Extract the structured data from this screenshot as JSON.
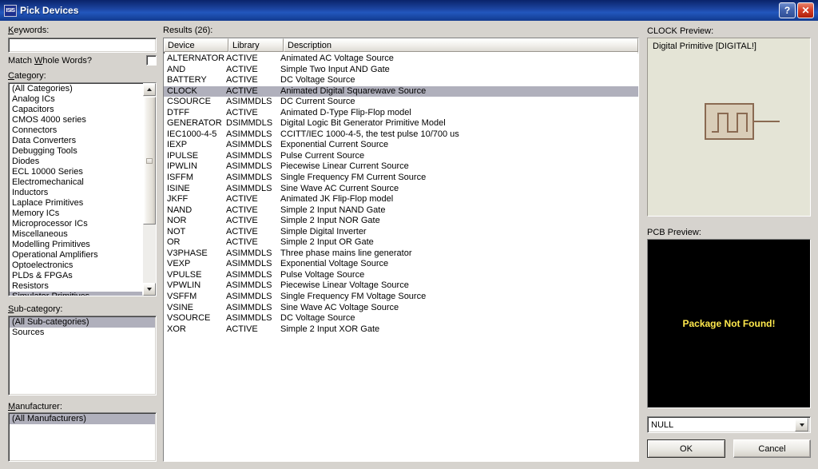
{
  "window": {
    "title": "Pick Devices",
    "app_icon_text": "ISIS",
    "help_button": "?",
    "close_button": "✕"
  },
  "left_panel": {
    "keywords_label": "Keywords:",
    "keywords_value": "",
    "keywords_placeholder": "",
    "match_whole_words_label": "Match Whole Words?",
    "match_whole_words_checked": false,
    "category_label": "Category:",
    "categories": [
      "(All Categories)",
      "Analog ICs",
      "Capacitors",
      "CMOS 4000 series",
      "Connectors",
      "Data Converters",
      "Debugging Tools",
      "Diodes",
      "ECL 10000 Series",
      "Electromechanical",
      "Inductors",
      "Laplace Primitives",
      "Memory ICs",
      "Microprocessor ICs",
      "Miscellaneous",
      "Modelling Primitives",
      "Operational Amplifiers",
      "Optoelectronics",
      "PLDs & FPGAs",
      "Resistors",
      "Simulator Primitives"
    ],
    "category_selected": "Simulator Primitives",
    "subcategory_label": "Sub-category:",
    "subcategories": [
      "(All Sub-categories)",
      "Sources"
    ],
    "subcategory_selected": "(All Sub-categories)",
    "manufacturer_label": "Manufacturer:",
    "manufacturers": [
      "(All Manufacturers)"
    ],
    "manufacturer_selected": "(All Manufacturers)"
  },
  "results": {
    "label": "Results (26):",
    "columns": [
      "Device",
      "Library",
      "Description"
    ],
    "selected_device": "CLOCK",
    "rows": [
      {
        "device": "ALTERNATOR",
        "library": "ACTIVE",
        "description": "Animated AC Voltage Source"
      },
      {
        "device": "AND",
        "library": "ACTIVE",
        "description": "Simple Two Input AND Gate"
      },
      {
        "device": "BATTERY",
        "library": "ACTIVE",
        "description": "DC Voltage Source"
      },
      {
        "device": "CLOCK",
        "library": "ACTIVE",
        "description": "Animated Digital Squarewave Source"
      },
      {
        "device": "CSOURCE",
        "library": "ASIMMDLS",
        "description": "DC Current Source"
      },
      {
        "device": "DTFF",
        "library": "ACTIVE",
        "description": "Animated D-Type Flip-Flop model"
      },
      {
        "device": "GENERATOR",
        "library": "DSIMMDLS",
        "description": "Digital Logic Bit Generator Primitive Model"
      },
      {
        "device": "IEC1000-4-5",
        "library": "ASIMMDLS",
        "description": "CCITT/IEC 1000-4-5, the test pulse 10/700 us"
      },
      {
        "device": "IEXP",
        "library": "ASIMMDLS",
        "description": "Exponential Current Source"
      },
      {
        "device": "IPULSE",
        "library": "ASIMMDLS",
        "description": "Pulse Current Source"
      },
      {
        "device": "IPWLIN",
        "library": "ASIMMDLS",
        "description": "Piecewise Linear Current Source"
      },
      {
        "device": "ISFFM",
        "library": "ASIMMDLS",
        "description": "Single Frequency FM Current Source"
      },
      {
        "device": "ISINE",
        "library": "ASIMMDLS",
        "description": "Sine Wave AC Current Source"
      },
      {
        "device": "JKFF",
        "library": "ACTIVE",
        "description": "Animated JK Flip-Flop model"
      },
      {
        "device": "NAND",
        "library": "ACTIVE",
        "description": "Simple 2 Input NAND Gate"
      },
      {
        "device": "NOR",
        "library": "ACTIVE",
        "description": "Simple 2 Input NOR Gate"
      },
      {
        "device": "NOT",
        "library": "ACTIVE",
        "description": "Simple Digital Inverter"
      },
      {
        "device": "OR",
        "library": "ACTIVE",
        "description": "Simple 2 Input OR Gate"
      },
      {
        "device": "V3PHASE",
        "library": "ASIMMDLS",
        "description": "Three phase mains line generator"
      },
      {
        "device": "VEXP",
        "library": "ASIMMDLS",
        "description": "Exponential Voltage Source"
      },
      {
        "device": "VPULSE",
        "library": "ASIMMDLS",
        "description": "Pulse Voltage Source"
      },
      {
        "device": "VPWLIN",
        "library": "ASIMMDLS",
        "description": "Piecewise Linear Voltage Source"
      },
      {
        "device": "VSFFM",
        "library": "ASIMMDLS",
        "description": "Single Frequency FM Voltage Source"
      },
      {
        "device": "VSINE",
        "library": "ASIMMDLS",
        "description": "Sine Wave AC Voltage Source"
      },
      {
        "device": "VSOURCE",
        "library": "ASIMMDLS",
        "description": "DC Voltage Source"
      },
      {
        "device": "XOR",
        "library": "ACTIVE",
        "description": "Simple 2 Input XOR Gate"
      }
    ]
  },
  "right_panel": {
    "clock_preview_label": "CLOCK Preview:",
    "clock_preview_note": "Digital Primitive [DIGITAL!]",
    "pcb_preview_label": "PCB Preview:",
    "pcb_preview_message": "Package Not Found!",
    "package_combo_value": "NULL",
    "ok_label": "OK",
    "cancel_label": "Cancel"
  },
  "colors": {
    "titlebar": "#0a246a",
    "dialog_face": "#d6d3ce",
    "selection": "#b0b0bc",
    "preview_bg": "#e4e4d6",
    "pcb_bg": "#000000",
    "pcb_text": "#ffe94d",
    "symbol_stroke": "#8a6a52",
    "symbol_fill": "#d9cdb8"
  }
}
